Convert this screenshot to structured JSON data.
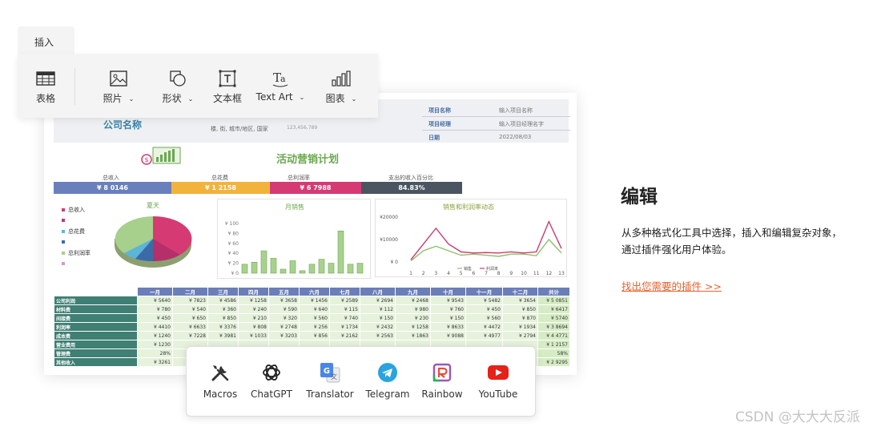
{
  "toolbar": {
    "tab_label": "插入",
    "items": [
      {
        "label": "表格",
        "icon": "table-icon",
        "dropdown": false
      },
      {
        "label": "照片",
        "icon": "image-icon",
        "dropdown": true
      },
      {
        "label": "形状",
        "icon": "shape-icon",
        "dropdown": true
      },
      {
        "label": "文本框",
        "icon": "textbox-icon",
        "dropdown": false
      },
      {
        "label": "Text Art",
        "icon": "text-art-icon",
        "dropdown": true
      },
      {
        "label": "图表",
        "icon": "bar-chart-icon",
        "dropdown": true
      }
    ],
    "chevron": "⌄"
  },
  "sheet": {
    "company": "公司名称",
    "address": "楼, 街, 城市/地区, 国家",
    "phone": "123,456,789",
    "meta": [
      {
        "key": "项目名称",
        "value": "输入项目名称"
      },
      {
        "key": "项目经理",
        "value": "输入项目经理名字"
      },
      {
        "key": "日期",
        "value": "2022/08/03"
      }
    ],
    "title": "活动营销计划",
    "kpis": [
      {
        "label": "总收入",
        "value": "¥ 8 0146",
        "color": "#6a80bd"
      },
      {
        "label": "总花费",
        "value": "¥ 1 2158",
        "color": "#f2b33d"
      },
      {
        "label": "总利润率",
        "value": "¥ 6 7988",
        "color": "#d63a72"
      },
      {
        "label": "支出的收入百分比",
        "value": "84.83%",
        "color": "#4a5561"
      }
    ],
    "pie": {
      "title": "夏天",
      "legend": [
        "总收入",
        "",
        "总花费",
        "",
        "总利润率",
        ""
      ],
      "legend_colors": [
        "#d63a72",
        "#b93a82",
        "#5bb5d8",
        "#3a6ba8",
        "#a8d08d",
        "#c9a0c9"
      ]
    },
    "monthly": {
      "title": "月销售",
      "yticks": [
        "¥ 100",
        "¥ 80",
        "¥ 60",
        "¥ 40",
        "¥ 20",
        "¥ 0"
      ]
    },
    "trend": {
      "title": "销售和利润率动态",
      "yticks": [
        "¥20000",
        "¥10000",
        "¥ 0"
      ],
      "xticks": [
        "1",
        "2",
        "3",
        "4",
        "5",
        "6",
        "7",
        "8",
        "9",
        "10",
        "11",
        "12",
        "13"
      ],
      "legend": [
        "销售",
        "利润率"
      ]
    },
    "table": {
      "headers": [
        "一月",
        "二月",
        "三月",
        "四月",
        "五月",
        "六月",
        "七月",
        "八月",
        "九月",
        "十月",
        "十一月",
        "十二月",
        "共计"
      ],
      "rows": [
        {
          "label": "公司利润",
          "values": [
            "¥ 5640",
            "¥ 7823",
            "¥ 4586",
            "¥ 1258",
            "¥ 3658",
            "¥ 1456",
            "¥ 2589",
            "¥ 2694",
            "¥ 2468",
            "¥ 9543",
            "¥ 5482",
            "¥ 3654",
            "¥ 5 0851"
          ]
        },
        {
          "label": "材料费",
          "values": [
            "¥ 780",
            "¥ 540",
            "¥ 360",
            "¥ 240",
            "¥ 590",
            "¥ 640",
            "¥ 115",
            "¥ 112",
            "¥ 980",
            "¥ 760",
            "¥ 450",
            "¥ 850",
            "¥ 6417"
          ]
        },
        {
          "label": "间接费",
          "values": [
            "¥ 450",
            "¥ 650",
            "¥ 850",
            "¥ 210",
            "¥ 320",
            "¥ 560",
            "¥ 740",
            "¥ 150",
            "¥ 230",
            "¥ 150",
            "¥ 560",
            "¥ 870",
            "¥ 5740"
          ]
        },
        {
          "label": "利润率",
          "values": [
            "¥ 4410",
            "¥ 6633",
            "¥ 3376",
            "¥ 808",
            "¥ 2748",
            "¥ 256",
            "¥ 1734",
            "¥ 2432",
            "¥ 1258",
            "¥ 8633",
            "¥ 4472",
            "¥ 1934",
            "¥ 3 8694"
          ]
        },
        {
          "label": "成本费",
          "values": [
            "¥ 1240",
            "¥ 7228",
            "¥ 3981",
            "¥ 1033",
            "¥ 3203",
            "¥ 856",
            "¥ 2162",
            "¥ 2563",
            "¥ 1863",
            "¥ 9088",
            "¥ 4977",
            "¥ 2794",
            "¥ 4 4771"
          ]
        },
        {
          "label": "营业费用",
          "values": [
            "¥ 1230",
            "",
            "",
            "",
            "",
            "",
            "",
            "",
            "",
            "",
            "",
            "",
            "¥ 1 2157"
          ]
        },
        {
          "label": "管理费",
          "values": [
            "28%",
            "",
            "",
            "",
            "",
            "",
            "",
            "",
            "",
            "",
            "",
            "",
            "58%"
          ]
        },
        {
          "label": "其他收入",
          "values": [
            "¥ 3261",
            "",
            "",
            "",
            "",
            "",
            "",
            "",
            "",
            "",
            "",
            "",
            "¥ 2 9295"
          ]
        }
      ]
    }
  },
  "plugins": [
    {
      "label": "Macros",
      "icon": "tools-icon"
    },
    {
      "label": "ChatGPT",
      "icon": "chatgpt-icon"
    },
    {
      "label": "Translator",
      "icon": "translator-icon"
    },
    {
      "label": "Telegram",
      "icon": "telegram-icon"
    },
    {
      "label": "Rainbow",
      "icon": "rainbow-icon"
    },
    {
      "label": "YouTube",
      "icon": "youtube-icon"
    }
  ],
  "side": {
    "heading": "编辑",
    "line1": "从多种格式化工具中选择，插入和编辑复杂对象，",
    "line2": "通过插件强化用户体验。",
    "link": "找出您需要的插件 >>"
  },
  "watermark": "CSDN @大大大反派",
  "colors": {
    "accent": "#e8602c",
    "green": "#6aa84f",
    "table_header": "#6b7eb8",
    "row_label": "#3f7f74"
  }
}
